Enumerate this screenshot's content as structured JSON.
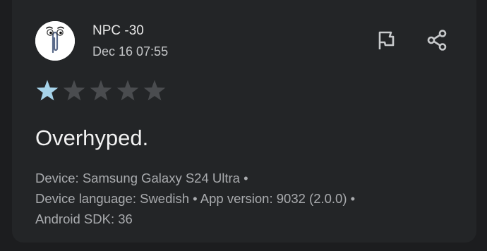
{
  "review": {
    "author": "NPC -30",
    "date": "Dec 16 07:55",
    "rating": 1,
    "max_rating": 5,
    "title": "Overhyped.",
    "meta_lines": [
      "Device: Samsung Galaxy S24 Ultra •",
      "Device language: Swedish • App version: 9032 (2.0.0) •",
      "Android SDK: 36"
    ]
  },
  "icons": {
    "avatar": "paperclip-mascot-icon",
    "flag": "flag-icon",
    "share": "share-icon",
    "star": "star-icon"
  },
  "colors": {
    "background": "#1c1d1f",
    "card": "#232527",
    "star_filled": "#a6d3ea",
    "star_empty": "#4a4c4f",
    "icon": "#c8cacc"
  }
}
